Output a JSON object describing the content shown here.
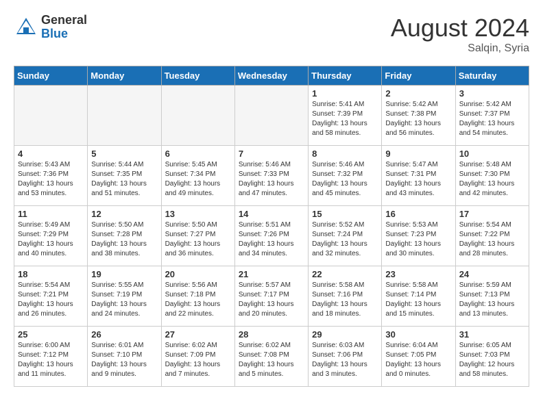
{
  "header": {
    "logo_general": "General",
    "logo_blue": "Blue",
    "month_year": "August 2024",
    "location": "Salqin, Syria"
  },
  "days_of_week": [
    "Sunday",
    "Monday",
    "Tuesday",
    "Wednesday",
    "Thursday",
    "Friday",
    "Saturday"
  ],
  "weeks": [
    [
      {
        "day": "",
        "info": ""
      },
      {
        "day": "",
        "info": ""
      },
      {
        "day": "",
        "info": ""
      },
      {
        "day": "",
        "info": ""
      },
      {
        "day": "1",
        "info": "Sunrise: 5:41 AM\nSunset: 7:39 PM\nDaylight: 13 hours\nand 58 minutes."
      },
      {
        "day": "2",
        "info": "Sunrise: 5:42 AM\nSunset: 7:38 PM\nDaylight: 13 hours\nand 56 minutes."
      },
      {
        "day": "3",
        "info": "Sunrise: 5:42 AM\nSunset: 7:37 PM\nDaylight: 13 hours\nand 54 minutes."
      }
    ],
    [
      {
        "day": "4",
        "info": "Sunrise: 5:43 AM\nSunset: 7:36 PM\nDaylight: 13 hours\nand 53 minutes."
      },
      {
        "day": "5",
        "info": "Sunrise: 5:44 AM\nSunset: 7:35 PM\nDaylight: 13 hours\nand 51 minutes."
      },
      {
        "day": "6",
        "info": "Sunrise: 5:45 AM\nSunset: 7:34 PM\nDaylight: 13 hours\nand 49 minutes."
      },
      {
        "day": "7",
        "info": "Sunrise: 5:46 AM\nSunset: 7:33 PM\nDaylight: 13 hours\nand 47 minutes."
      },
      {
        "day": "8",
        "info": "Sunrise: 5:46 AM\nSunset: 7:32 PM\nDaylight: 13 hours\nand 45 minutes."
      },
      {
        "day": "9",
        "info": "Sunrise: 5:47 AM\nSunset: 7:31 PM\nDaylight: 13 hours\nand 43 minutes."
      },
      {
        "day": "10",
        "info": "Sunrise: 5:48 AM\nSunset: 7:30 PM\nDaylight: 13 hours\nand 42 minutes."
      }
    ],
    [
      {
        "day": "11",
        "info": "Sunrise: 5:49 AM\nSunset: 7:29 PM\nDaylight: 13 hours\nand 40 minutes."
      },
      {
        "day": "12",
        "info": "Sunrise: 5:50 AM\nSunset: 7:28 PM\nDaylight: 13 hours\nand 38 minutes."
      },
      {
        "day": "13",
        "info": "Sunrise: 5:50 AM\nSunset: 7:27 PM\nDaylight: 13 hours\nand 36 minutes."
      },
      {
        "day": "14",
        "info": "Sunrise: 5:51 AM\nSunset: 7:26 PM\nDaylight: 13 hours\nand 34 minutes."
      },
      {
        "day": "15",
        "info": "Sunrise: 5:52 AM\nSunset: 7:24 PM\nDaylight: 13 hours\nand 32 minutes."
      },
      {
        "day": "16",
        "info": "Sunrise: 5:53 AM\nSunset: 7:23 PM\nDaylight: 13 hours\nand 30 minutes."
      },
      {
        "day": "17",
        "info": "Sunrise: 5:54 AM\nSunset: 7:22 PM\nDaylight: 13 hours\nand 28 minutes."
      }
    ],
    [
      {
        "day": "18",
        "info": "Sunrise: 5:54 AM\nSunset: 7:21 PM\nDaylight: 13 hours\nand 26 minutes."
      },
      {
        "day": "19",
        "info": "Sunrise: 5:55 AM\nSunset: 7:19 PM\nDaylight: 13 hours\nand 24 minutes."
      },
      {
        "day": "20",
        "info": "Sunrise: 5:56 AM\nSunset: 7:18 PM\nDaylight: 13 hours\nand 22 minutes."
      },
      {
        "day": "21",
        "info": "Sunrise: 5:57 AM\nSunset: 7:17 PM\nDaylight: 13 hours\nand 20 minutes."
      },
      {
        "day": "22",
        "info": "Sunrise: 5:58 AM\nSunset: 7:16 PM\nDaylight: 13 hours\nand 18 minutes."
      },
      {
        "day": "23",
        "info": "Sunrise: 5:58 AM\nSunset: 7:14 PM\nDaylight: 13 hours\nand 15 minutes."
      },
      {
        "day": "24",
        "info": "Sunrise: 5:59 AM\nSunset: 7:13 PM\nDaylight: 13 hours\nand 13 minutes."
      }
    ],
    [
      {
        "day": "25",
        "info": "Sunrise: 6:00 AM\nSunset: 7:12 PM\nDaylight: 13 hours\nand 11 minutes."
      },
      {
        "day": "26",
        "info": "Sunrise: 6:01 AM\nSunset: 7:10 PM\nDaylight: 13 hours\nand 9 minutes."
      },
      {
        "day": "27",
        "info": "Sunrise: 6:02 AM\nSunset: 7:09 PM\nDaylight: 13 hours\nand 7 minutes."
      },
      {
        "day": "28",
        "info": "Sunrise: 6:02 AM\nSunset: 7:08 PM\nDaylight: 13 hours\nand 5 minutes."
      },
      {
        "day": "29",
        "info": "Sunrise: 6:03 AM\nSunset: 7:06 PM\nDaylight: 13 hours\nand 3 minutes."
      },
      {
        "day": "30",
        "info": "Sunrise: 6:04 AM\nSunset: 7:05 PM\nDaylight: 13 hours\nand 0 minutes."
      },
      {
        "day": "31",
        "info": "Sunrise: 6:05 AM\nSunset: 7:03 PM\nDaylight: 12 hours\nand 58 minutes."
      }
    ]
  ]
}
